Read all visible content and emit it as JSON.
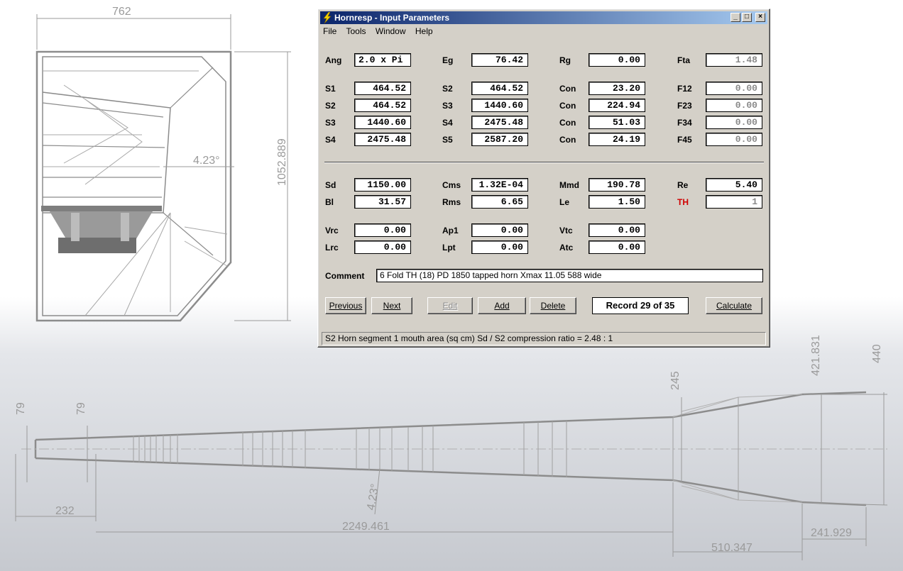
{
  "window": {
    "title": "Hornresp - Input Parameters",
    "menu": [
      "File",
      "Tools",
      "Window",
      "Help"
    ],
    "controls": {
      "minimize": "_",
      "maximize": "□",
      "close": "×"
    }
  },
  "params": {
    "row1": [
      {
        "label": "Ang",
        "value": "2.0 x Pi"
      },
      {
        "label": "Eg",
        "value": "76.42"
      },
      {
        "label": "Rg",
        "value": "0.00"
      },
      {
        "label": "Fta",
        "value": "1.48"
      }
    ],
    "horn": [
      [
        {
          "label": "S1",
          "value": "464.52"
        },
        {
          "label": "S2",
          "value": "464.52"
        },
        {
          "label": "Con",
          "value": "23.20"
        },
        {
          "label": "F12",
          "value": "0.00"
        }
      ],
      [
        {
          "label": "S2",
          "value": "464.52"
        },
        {
          "label": "S3",
          "value": "1440.60"
        },
        {
          "label": "Con",
          "value": "224.94"
        },
        {
          "label": "F23",
          "value": "0.00"
        }
      ],
      [
        {
          "label": "S3",
          "value": "1440.60"
        },
        {
          "label": "S4",
          "value": "2475.48"
        },
        {
          "label": "Con",
          "value": "51.03"
        },
        {
          "label": "F34",
          "value": "0.00"
        }
      ],
      [
        {
          "label": "S4",
          "value": "2475.48"
        },
        {
          "label": "S5",
          "value": "2587.20"
        },
        {
          "label": "Con",
          "value": "24.19"
        },
        {
          "label": "F45",
          "value": "0.00"
        }
      ]
    ],
    "driver": [
      [
        {
          "label": "Sd",
          "value": "1150.00"
        },
        {
          "label": "Cms",
          "value": "1.32E-04"
        },
        {
          "label": "Mmd",
          "value": "190.78"
        },
        {
          "label": "Re",
          "value": "5.40"
        }
      ],
      [
        {
          "label": "Bl",
          "value": "31.57"
        },
        {
          "label": "Rms",
          "value": "6.65"
        },
        {
          "label": "Le",
          "value": "1.50"
        },
        {
          "label": "TH",
          "value": "1"
        }
      ]
    ],
    "chambers": [
      [
        {
          "label": "Vrc",
          "value": "0.00"
        },
        {
          "label": "Ap1",
          "value": "0.00"
        },
        {
          "label": "Vtc",
          "value": "0.00"
        }
      ],
      [
        {
          "label": "Lrc",
          "value": "0.00"
        },
        {
          "label": "Lpt",
          "value": "0.00"
        },
        {
          "label": "Atc",
          "value": "0.00"
        }
      ]
    ],
    "comment_label": "Comment",
    "comment_value": "6 Fold TH (18) PD 1850 tapped horn  Xmax 11.05 588 wide"
  },
  "buttons": {
    "previous": "Previous",
    "next": "Next",
    "edit": "Edit",
    "add": "Add",
    "delete": "Delete",
    "record": "Record 29 of 35",
    "calculate": "Calculate"
  },
  "status": "S2   Horn segment 1 mouth area  (sq cm)   Sd / S2 compression ratio = 2.48 : 1",
  "drawing": {
    "top_width": "762",
    "top_height": "1052.889",
    "top_angle": "4.23°",
    "side_left_1": "79",
    "side_left_2": "79",
    "side_mid": "245",
    "side_r1": "421.831",
    "side_r2": "440",
    "bottom_1": "232",
    "bottom_2": "2249.461",
    "bottom_3": "510.347",
    "bottom_4": "241.929",
    "side_angle": "4.23°"
  },
  "colors": {
    "title_start": "#0a246a",
    "title_end": "#a6caf0",
    "face": "#d4d0c8",
    "th_label": "#d00000"
  }
}
